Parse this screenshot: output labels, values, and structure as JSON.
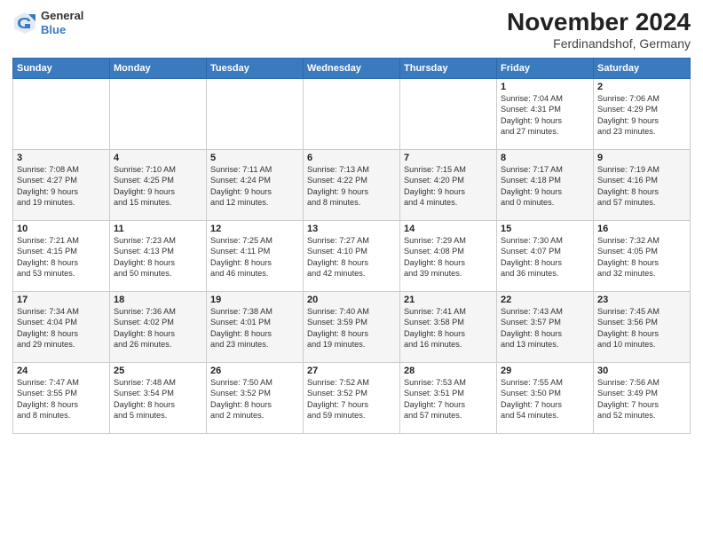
{
  "logo": {
    "general": "General",
    "blue": "Blue"
  },
  "header": {
    "month": "November 2024",
    "location": "Ferdinandshof, Germany"
  },
  "weekdays": [
    "Sunday",
    "Monday",
    "Tuesday",
    "Wednesday",
    "Thursday",
    "Friday",
    "Saturday"
  ],
  "weeks": [
    [
      {
        "day": "",
        "info": ""
      },
      {
        "day": "",
        "info": ""
      },
      {
        "day": "",
        "info": ""
      },
      {
        "day": "",
        "info": ""
      },
      {
        "day": "",
        "info": ""
      },
      {
        "day": "1",
        "info": "Sunrise: 7:04 AM\nSunset: 4:31 PM\nDaylight: 9 hours\nand 27 minutes."
      },
      {
        "day": "2",
        "info": "Sunrise: 7:06 AM\nSunset: 4:29 PM\nDaylight: 9 hours\nand 23 minutes."
      }
    ],
    [
      {
        "day": "3",
        "info": "Sunrise: 7:08 AM\nSunset: 4:27 PM\nDaylight: 9 hours\nand 19 minutes."
      },
      {
        "day": "4",
        "info": "Sunrise: 7:10 AM\nSunset: 4:25 PM\nDaylight: 9 hours\nand 15 minutes."
      },
      {
        "day": "5",
        "info": "Sunrise: 7:11 AM\nSunset: 4:24 PM\nDaylight: 9 hours\nand 12 minutes."
      },
      {
        "day": "6",
        "info": "Sunrise: 7:13 AM\nSunset: 4:22 PM\nDaylight: 9 hours\nand 8 minutes."
      },
      {
        "day": "7",
        "info": "Sunrise: 7:15 AM\nSunset: 4:20 PM\nDaylight: 9 hours\nand 4 minutes."
      },
      {
        "day": "8",
        "info": "Sunrise: 7:17 AM\nSunset: 4:18 PM\nDaylight: 9 hours\nand 0 minutes."
      },
      {
        "day": "9",
        "info": "Sunrise: 7:19 AM\nSunset: 4:16 PM\nDaylight: 8 hours\nand 57 minutes."
      }
    ],
    [
      {
        "day": "10",
        "info": "Sunrise: 7:21 AM\nSunset: 4:15 PM\nDaylight: 8 hours\nand 53 minutes."
      },
      {
        "day": "11",
        "info": "Sunrise: 7:23 AM\nSunset: 4:13 PM\nDaylight: 8 hours\nand 50 minutes."
      },
      {
        "day": "12",
        "info": "Sunrise: 7:25 AM\nSunset: 4:11 PM\nDaylight: 8 hours\nand 46 minutes."
      },
      {
        "day": "13",
        "info": "Sunrise: 7:27 AM\nSunset: 4:10 PM\nDaylight: 8 hours\nand 42 minutes."
      },
      {
        "day": "14",
        "info": "Sunrise: 7:29 AM\nSunset: 4:08 PM\nDaylight: 8 hours\nand 39 minutes."
      },
      {
        "day": "15",
        "info": "Sunrise: 7:30 AM\nSunset: 4:07 PM\nDaylight: 8 hours\nand 36 minutes."
      },
      {
        "day": "16",
        "info": "Sunrise: 7:32 AM\nSunset: 4:05 PM\nDaylight: 8 hours\nand 32 minutes."
      }
    ],
    [
      {
        "day": "17",
        "info": "Sunrise: 7:34 AM\nSunset: 4:04 PM\nDaylight: 8 hours\nand 29 minutes."
      },
      {
        "day": "18",
        "info": "Sunrise: 7:36 AM\nSunset: 4:02 PM\nDaylight: 8 hours\nand 26 minutes."
      },
      {
        "day": "19",
        "info": "Sunrise: 7:38 AM\nSunset: 4:01 PM\nDaylight: 8 hours\nand 23 minutes."
      },
      {
        "day": "20",
        "info": "Sunrise: 7:40 AM\nSunset: 3:59 PM\nDaylight: 8 hours\nand 19 minutes."
      },
      {
        "day": "21",
        "info": "Sunrise: 7:41 AM\nSunset: 3:58 PM\nDaylight: 8 hours\nand 16 minutes."
      },
      {
        "day": "22",
        "info": "Sunrise: 7:43 AM\nSunset: 3:57 PM\nDaylight: 8 hours\nand 13 minutes."
      },
      {
        "day": "23",
        "info": "Sunrise: 7:45 AM\nSunset: 3:56 PM\nDaylight: 8 hours\nand 10 minutes."
      }
    ],
    [
      {
        "day": "24",
        "info": "Sunrise: 7:47 AM\nSunset: 3:55 PM\nDaylight: 8 hours\nand 8 minutes."
      },
      {
        "day": "25",
        "info": "Sunrise: 7:48 AM\nSunset: 3:54 PM\nDaylight: 8 hours\nand 5 minutes."
      },
      {
        "day": "26",
        "info": "Sunrise: 7:50 AM\nSunset: 3:52 PM\nDaylight: 8 hours\nand 2 minutes."
      },
      {
        "day": "27",
        "info": "Sunrise: 7:52 AM\nSunset: 3:52 PM\nDaylight: 7 hours\nand 59 minutes."
      },
      {
        "day": "28",
        "info": "Sunrise: 7:53 AM\nSunset: 3:51 PM\nDaylight: 7 hours\nand 57 minutes."
      },
      {
        "day": "29",
        "info": "Sunrise: 7:55 AM\nSunset: 3:50 PM\nDaylight: 7 hours\nand 54 minutes."
      },
      {
        "day": "30",
        "info": "Sunrise: 7:56 AM\nSunset: 3:49 PM\nDaylight: 7 hours\nand 52 minutes."
      }
    ]
  ]
}
